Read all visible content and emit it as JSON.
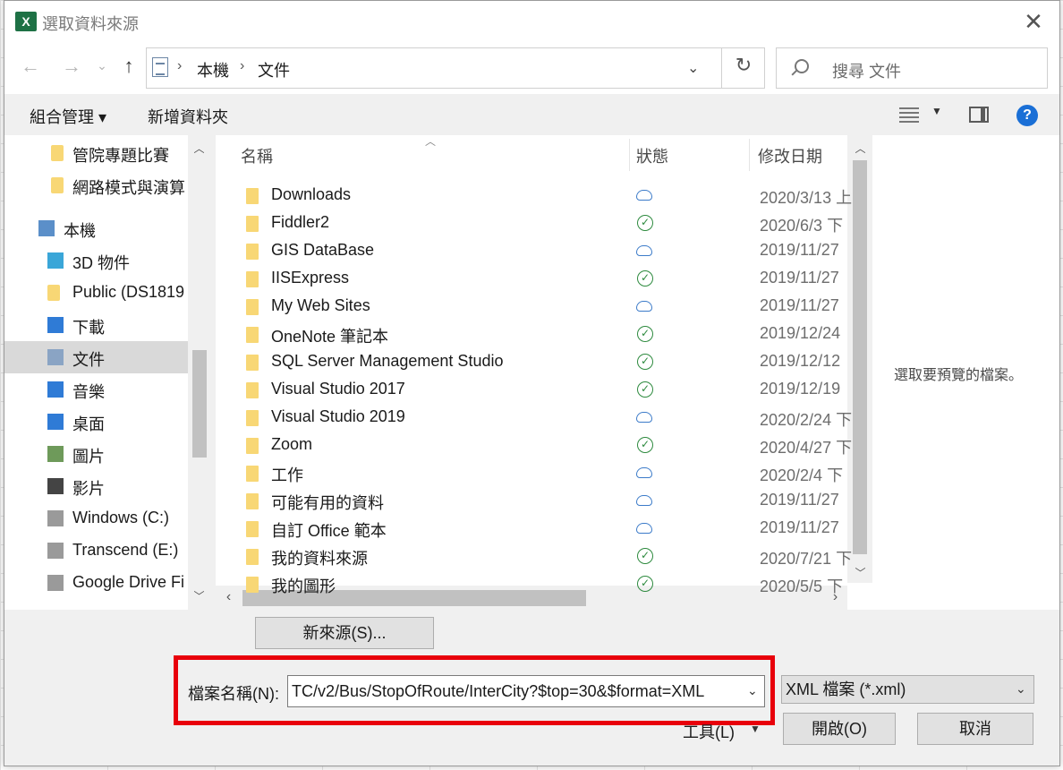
{
  "dialog": {
    "title": "選取資料來源",
    "app_icon_text": "X",
    "close_glyph": "✕"
  },
  "nav": {
    "back_glyph": "←",
    "forward_glyph": "→",
    "recent_glyph": "⌄",
    "up_glyph": "↑",
    "breadcrumb": [
      "本機",
      "文件"
    ],
    "crumb_sep": "›",
    "dropdown_glyph": "⌄",
    "refresh_glyph": "↻",
    "search_placeholder": "搜尋 文件"
  },
  "commands": {
    "organize": "組合管理 ▾",
    "new_folder": "新增資料夾",
    "help": "?"
  },
  "tree": {
    "items": [
      {
        "label": "管院專題比賽",
        "icon": "folder-icon"
      },
      {
        "label": "網路模式與演算",
        "icon": "folder-icon"
      },
      {
        "label": "本機",
        "icon": "computer-icon"
      },
      {
        "label": "3D 物件",
        "icon": "3d-objects-icon"
      },
      {
        "label": "Public (DS1819",
        "icon": "folder-icon"
      },
      {
        "label": "下載",
        "icon": "download-icon"
      },
      {
        "label": "文件",
        "icon": "document-icon"
      },
      {
        "label": "音樂",
        "icon": "music-icon"
      },
      {
        "label": "桌面",
        "icon": "desktop-icon"
      },
      {
        "label": "圖片",
        "icon": "pictures-icon"
      },
      {
        "label": "影片",
        "icon": "videos-icon"
      },
      {
        "label": "Windows (C:)",
        "icon": "drive-icon"
      },
      {
        "label": "Transcend (E:)",
        "icon": "drive-icon"
      },
      {
        "label": "Google Drive Fi",
        "icon": "drive-icon"
      }
    ]
  },
  "filelist": {
    "columns": {
      "name": "名稱",
      "status": "狀態",
      "modified": "修改日期"
    },
    "rows": [
      {
        "name": "Downloads",
        "status": "cloud",
        "date": "2020/3/13 上"
      },
      {
        "name": "Fiddler2",
        "status": "synced",
        "date": "2020/6/3 下"
      },
      {
        "name": "GIS DataBase",
        "status": "cloud",
        "date": "2019/11/27"
      },
      {
        "name": "IISExpress",
        "status": "synced",
        "date": "2019/11/27"
      },
      {
        "name": "My Web Sites",
        "status": "cloud",
        "date": "2019/11/27"
      },
      {
        "name": "OneNote 筆記本",
        "status": "synced",
        "date": "2019/12/24"
      },
      {
        "name": "SQL Server Management Studio",
        "status": "synced",
        "date": "2019/12/12"
      },
      {
        "name": "Visual Studio 2017",
        "status": "synced",
        "date": "2019/12/19"
      },
      {
        "name": "Visual Studio 2019",
        "status": "cloud",
        "date": "2020/2/24 下"
      },
      {
        "name": "Zoom",
        "status": "synced",
        "date": "2020/4/27 下"
      },
      {
        "name": "工作",
        "status": "cloud",
        "date": "2020/2/4 下"
      },
      {
        "name": "可能有用的資料",
        "status": "cloud",
        "date": "2019/11/27"
      },
      {
        "name": "自訂 Office 範本",
        "status": "cloud",
        "date": "2019/11/27"
      },
      {
        "name": "我的資料來源",
        "status": "synced",
        "date": "2020/7/21 下"
      },
      {
        "name": "我的圖形",
        "status": "synced",
        "date": "2020/5/5 下"
      }
    ]
  },
  "preview": {
    "text": "選取要預覽的檔案。"
  },
  "bottom": {
    "new_source_button": "新來源(S)...",
    "filename_label": "檔案名稱(N):",
    "filename_value": "TC/v2/Bus/StopOfRoute/InterCity?$top=30&$format=XML",
    "filetype_value": "XML 檔案 (*.xml)",
    "tools_label": "工具(L)",
    "open_button": "開啟(O)",
    "cancel_button": "取消"
  },
  "colors": {
    "highlight_box": "#e8000b",
    "excel_green": "#1e7145",
    "cloud_status": "#3c7bc9",
    "synced_status": "#2d8a3e"
  }
}
